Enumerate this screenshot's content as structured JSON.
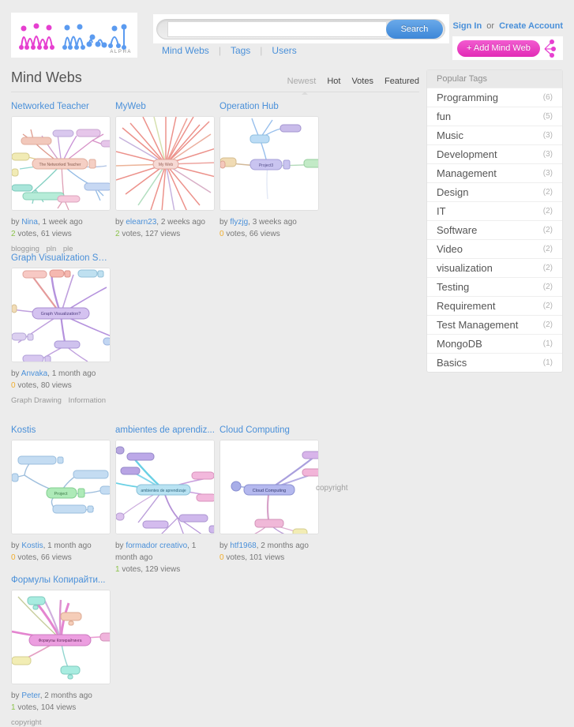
{
  "header": {
    "logo_text": "ViviMind",
    "logo_badge": "ALPHA",
    "search": {
      "value": "",
      "placeholder": "",
      "button_label": "Search"
    },
    "nav": [
      {
        "label": "Mind Webs"
      },
      {
        "label": "Tags"
      },
      {
        "label": "Users"
      }
    ],
    "nav_separator": "|",
    "account": {
      "sign_in": "Sign In",
      "or": "or",
      "create_account": "Create Account"
    },
    "add_button_label": "+ Add Mind Web"
  },
  "main": {
    "page_title": "Mind Webs",
    "sorts": [
      {
        "label": "Newest",
        "active": true
      },
      {
        "label": "Hot",
        "active": false
      },
      {
        "label": "Votes",
        "active": false
      },
      {
        "label": "Featured",
        "active": false
      }
    ],
    "cards": [
      {
        "title": "Networked Teacher",
        "author": "Nina",
        "time": "1 week ago",
        "votes": "2",
        "votes_label": "votes,",
        "views": "61 views",
        "votes_state": "positive",
        "tags": [
          "blogging",
          "pln",
          "ple"
        ],
        "thumb": {
          "center_label": "The Networked Teacher",
          "style": "radial-salmon"
        }
      },
      {
        "title": "MyWeb",
        "author": "elearn23",
        "time": "2 weeks ago",
        "votes": "2",
        "votes_label": "votes,",
        "views": "127 views",
        "votes_state": "positive",
        "tags": [],
        "thumb": {
          "center_label": "My Web",
          "style": "starburst-red"
        }
      },
      {
        "title": "Operation Hub",
        "author": "flyzjg",
        "time": "3 weeks ago",
        "votes": "0",
        "votes_label": "votes,",
        "views": "66 views",
        "votes_state": "zero",
        "tags": [],
        "thumb": {
          "center_label": "Project3",
          "style": "sparse-purple"
        }
      },
      {
        "title": "Graph Visualization So...",
        "author": "Anvaka",
        "time": "1 month ago",
        "votes": "0",
        "votes_label": "votes,",
        "views": "80 views",
        "votes_state": "zero",
        "tags": [
          "Graph Drawing",
          "Information"
        ],
        "thumb": {
          "center_label": "Graph Visualization?",
          "style": "violet-branch"
        }
      },
      {
        "title": "Kostis",
        "author": "Kostis",
        "time": "1 month ago",
        "votes": "0",
        "votes_label": "votes,",
        "views": "66 views",
        "votes_state": "zero",
        "tags": [],
        "thumb": {
          "center_label": "Project",
          "style": "green-blue"
        }
      },
      {
        "title": "ambientes de aprendiz...",
        "author": "formador creativo",
        "time": "1 month ago",
        "votes": "1",
        "votes_label": "votes,",
        "views": "129 views",
        "votes_state": "positive",
        "tags": [],
        "thumb": {
          "center_label": "ambientes de aprendizaje",
          "style": "cyan-violet"
        }
      },
      {
        "title": "Cloud Computing",
        "author": "htf1968",
        "time": "2 months ago",
        "votes": "0",
        "votes_label": "votes,",
        "views": "101 views",
        "votes_state": "zero",
        "tags": [],
        "thumb": {
          "center_label": "Cloud Computing",
          "style": "periwinkle-pink"
        }
      },
      {
        "title": "Формулы Копирайти...",
        "author": "Peter",
        "time": "2 months ago",
        "votes": "1",
        "votes_label": "votes,",
        "views": "104 views",
        "votes_state": "positive",
        "tags": [
          "copyright"
        ],
        "thumb": {
          "center_label": "Формулы Копирайтинга",
          "style": "magenta-radial"
        }
      }
    ],
    "by_prefix": "by",
    "comma": ",",
    "footer_copyright": "copyright"
  },
  "sidebar": {
    "heading": "Popular Tags",
    "tags": [
      {
        "name": "Programming",
        "count": "(6)"
      },
      {
        "name": "fun",
        "count": "(5)"
      },
      {
        "name": "Music",
        "count": "(3)"
      },
      {
        "name": "Development",
        "count": "(3)"
      },
      {
        "name": "Management",
        "count": "(3)"
      },
      {
        "name": "Design",
        "count": "(2)"
      },
      {
        "name": "IT",
        "count": "(2)"
      },
      {
        "name": "Software",
        "count": "(2)"
      },
      {
        "name": "Video",
        "count": "(2)"
      },
      {
        "name": "visualization",
        "count": "(2)"
      },
      {
        "name": "Testing",
        "count": "(2)"
      },
      {
        "name": "Requirement",
        "count": "(2)"
      },
      {
        "name": "Test Management",
        "count": "(2)"
      },
      {
        "name": "MongoDB",
        "count": "(1)"
      },
      {
        "name": "Basics",
        "count": "(1)"
      }
    ]
  },
  "colors": {
    "link": "#4a90d9",
    "accent_pink": "#e22bb6",
    "votes_positive": "#8bc34a",
    "votes_zero": "#f0ad2e",
    "page_bg": "#ececec"
  }
}
